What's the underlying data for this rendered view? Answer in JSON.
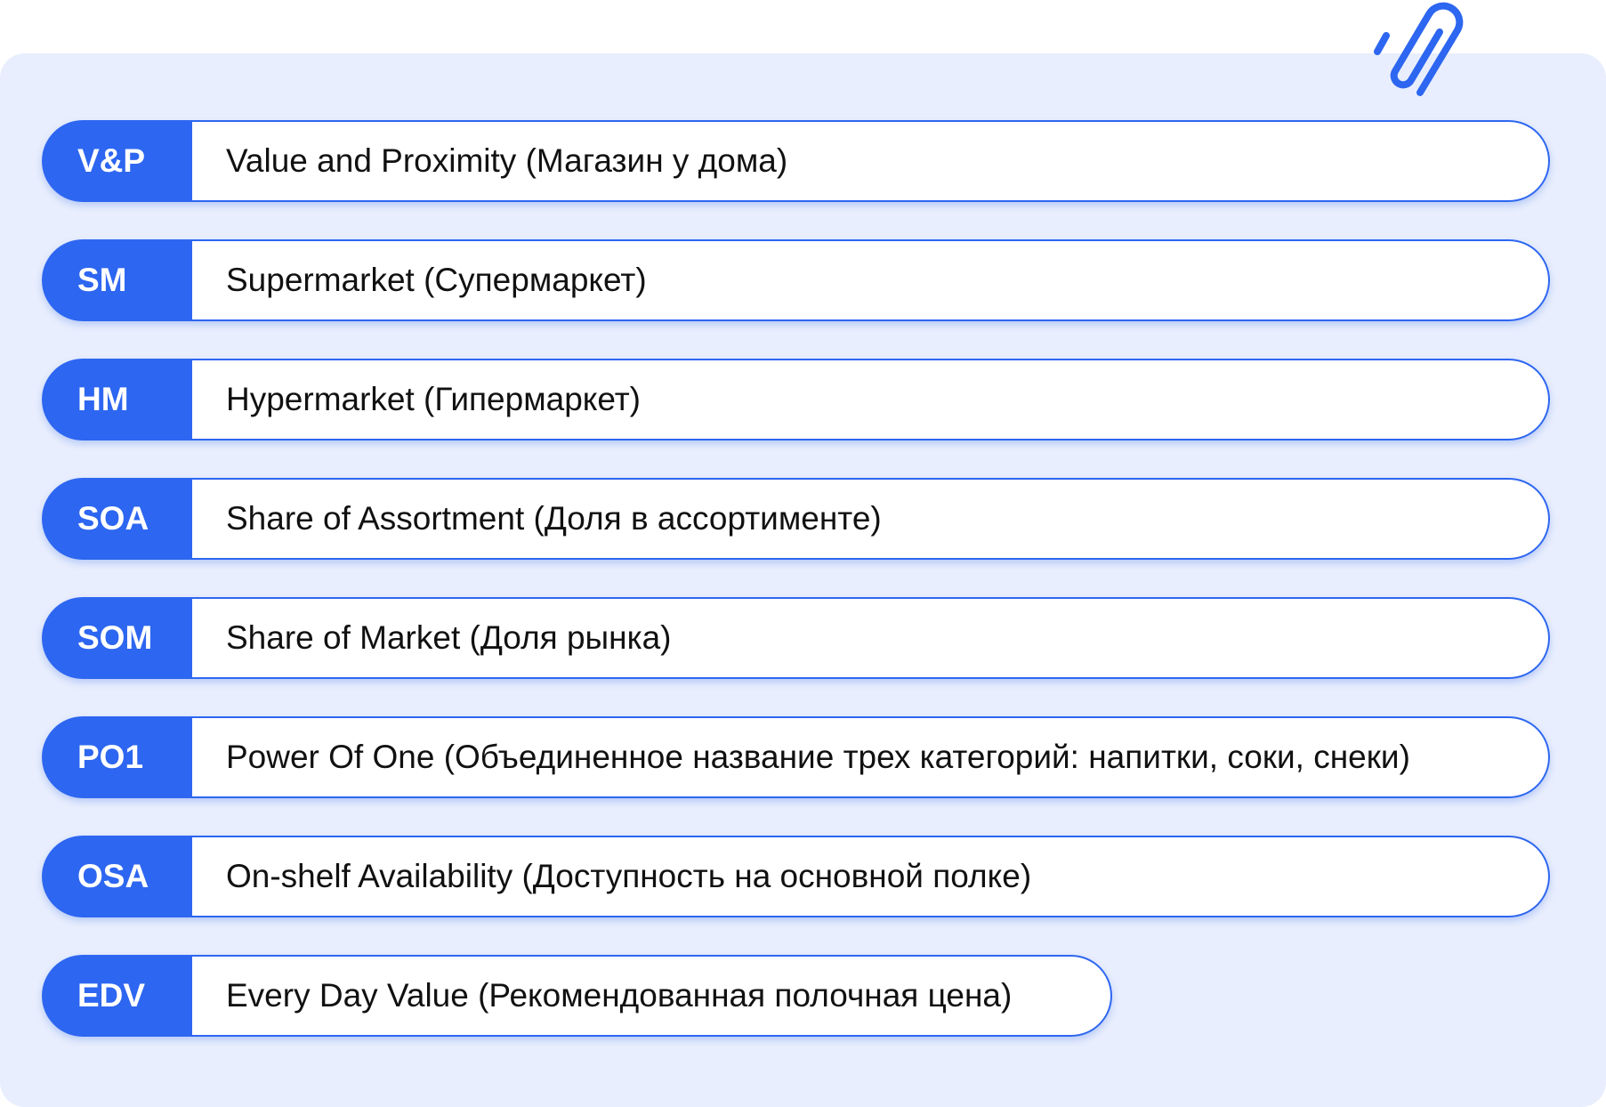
{
  "colors": {
    "accent": "#2d66f0",
    "background_panel": "#e8eefd",
    "text": "#111111"
  },
  "decoration": {
    "icon": "paperclip-icon"
  },
  "terms": [
    {
      "abbr": "V&P",
      "text": "Value and Proximity (Магазин у дома)"
    },
    {
      "abbr": "SM",
      "text": "Supermarket (Супермаркет)"
    },
    {
      "abbr": "HM",
      "text": "Hypermarket (Гипермаркет)"
    },
    {
      "abbr": "SOA",
      "text": "Share of Assortment (Доля в ассортименте)"
    },
    {
      "abbr": "SOM",
      "text": "Share of Market (Доля рынка)"
    },
    {
      "abbr": "PO1",
      "text": "Power Of One (Объединенное название трех категорий: напитки, соки, снеки)"
    },
    {
      "abbr": "OSA",
      "text": "On-shelf Availability (Доступность на основной полке)"
    },
    {
      "abbr": "EDV",
      "text": "Every Day Value (Рекомендованная полочная цена)"
    }
  ]
}
